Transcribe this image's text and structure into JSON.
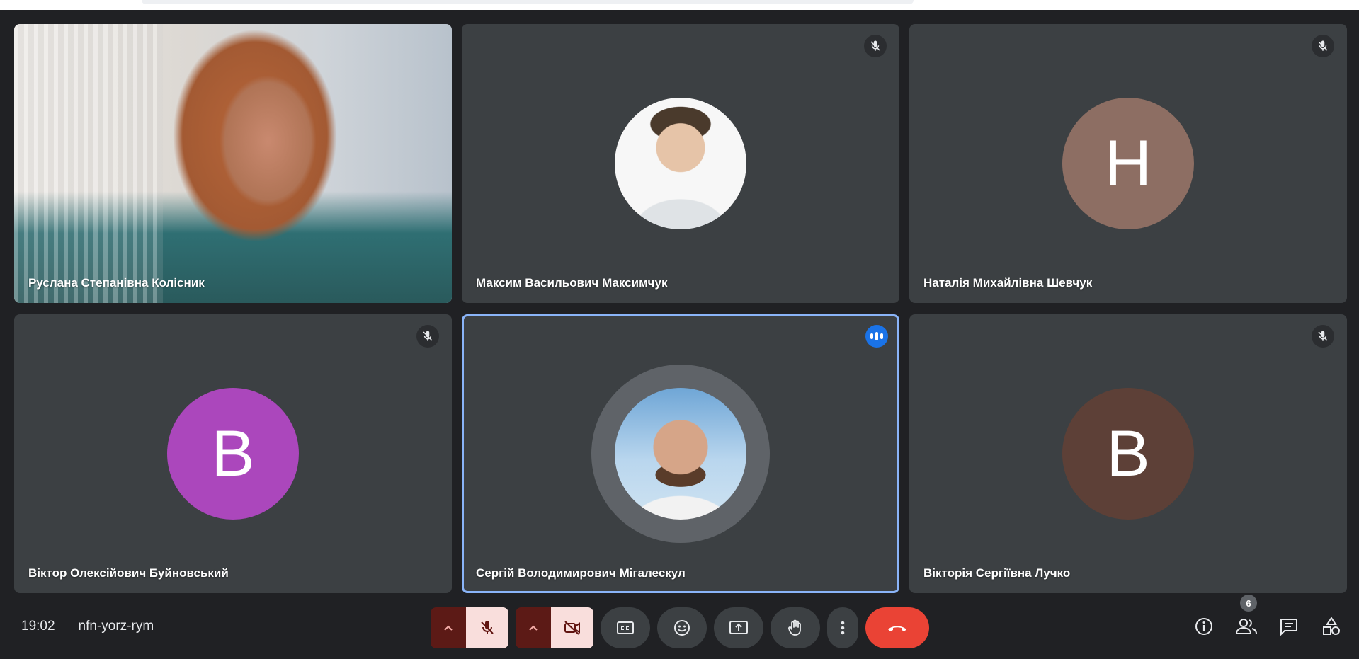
{
  "participants": [
    {
      "name": "Руслана Степанівна Колісник",
      "mode": "video",
      "muted": false
    },
    {
      "name": "Максим Васильович Максимчук",
      "mode": "photo",
      "muted": true
    },
    {
      "name": "Наталія Михайлівна Шевчук",
      "mode": "initial",
      "initial": "Н",
      "color": "#8d6e63",
      "muted": true
    },
    {
      "name": "Віктор Олексійович Буйновський",
      "mode": "initial",
      "initial": "В",
      "color": "#ab47bc",
      "muted": true
    },
    {
      "name": "Сергій Володимирович Мігалескул",
      "mode": "photo",
      "speaking": true,
      "active": true
    },
    {
      "name": "Вікторія Сергіївна Лучко",
      "mode": "initial",
      "initial": "В",
      "color": "#5d4037",
      "muted": true
    }
  ],
  "meeting": {
    "time": "19:02",
    "code": "nfn-yorz-rym"
  },
  "people_count": "6",
  "colors": {
    "accent_blue": "#8ab4f8",
    "end_call": "#ea4335",
    "mic_off_bg": "#f9dedc"
  },
  "icons": {
    "mic": "mic-off-icon",
    "camera": "camera-off-icon",
    "captions": "captions-icon",
    "emoji": "emoji-icon",
    "present": "present-icon",
    "hand": "raise-hand-icon",
    "more": "more-vert-icon",
    "end": "end-call-icon",
    "info": "info-icon",
    "people": "people-icon",
    "chat": "chat-icon",
    "activities": "activities-icon"
  }
}
